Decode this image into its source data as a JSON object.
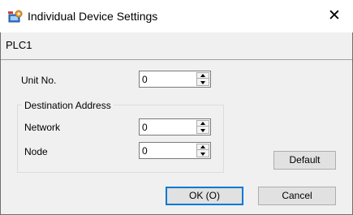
{
  "window": {
    "title": "Individual Device Settings",
    "close_glyph": "✕",
    "icon": "settings-app-icon"
  },
  "device": {
    "name": "PLC1"
  },
  "form": {
    "unit_no": {
      "label": "Unit No.",
      "value": "0"
    },
    "destination_group": {
      "title": "Destination Address",
      "network": {
        "label": "Network",
        "value": "0"
      },
      "node": {
        "label": "Node",
        "value": "0"
      }
    }
  },
  "buttons": {
    "default": "Default",
    "ok": "OK (O)",
    "cancel": "Cancel"
  },
  "colors": {
    "client_bg": "#f0f0f0",
    "button_bg": "#e1e1e1",
    "focus_border": "#0078d7"
  }
}
